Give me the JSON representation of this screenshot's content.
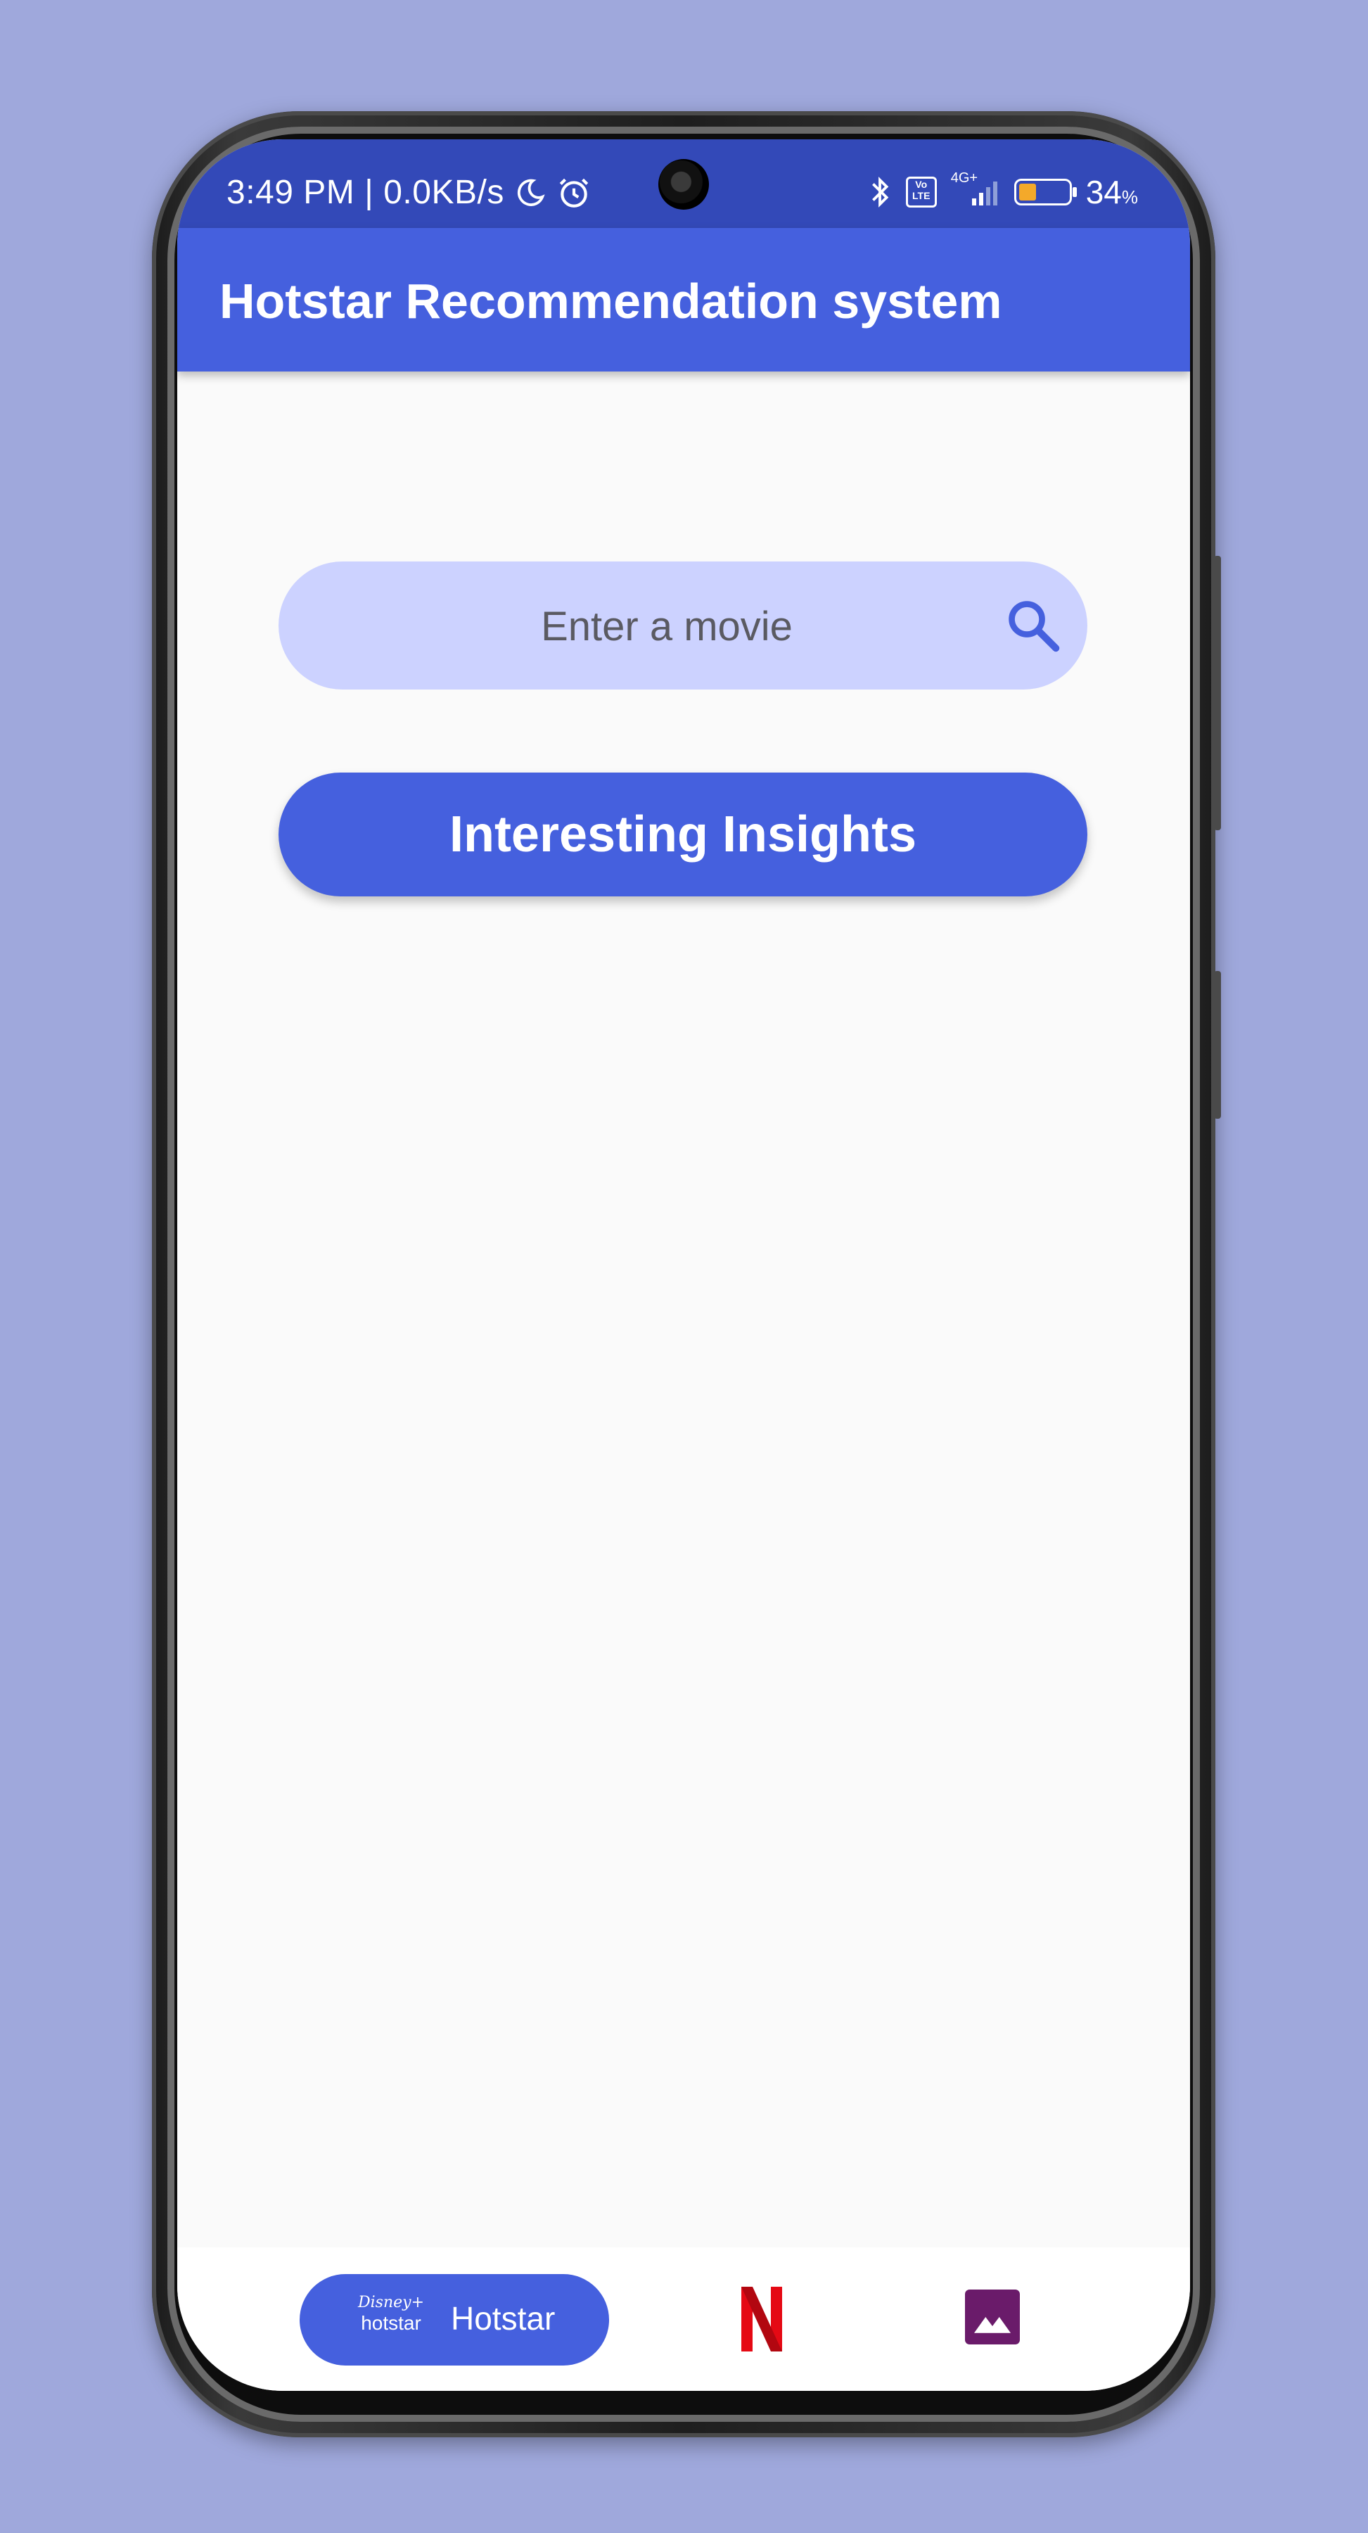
{
  "status_bar": {
    "time": "3:49 PM",
    "separator": "|",
    "network_speed": "0.0KB/s",
    "battery_percent": "34",
    "battery_unit": "%",
    "icons": [
      "moon-icon",
      "alarm-icon",
      "bluetooth-icon",
      "volte-icon",
      "signal-icon",
      "battery-icon"
    ],
    "volte_label": "Vo LTE",
    "network_type": "4G+"
  },
  "app_bar": {
    "title": "Hotstar Recommendation system"
  },
  "search": {
    "placeholder": "Enter a movie",
    "value": "",
    "icon": "search-icon"
  },
  "insights_button": {
    "label": "Interesting Insights"
  },
  "bottom_nav": {
    "items": [
      {
        "label": "Hotstar",
        "icon": "disney-hotstar-logo",
        "logo_line1": "Disney+",
        "logo_line2": "hotstar",
        "active": true
      },
      {
        "label": "",
        "icon": "netflix-icon",
        "active": false
      },
      {
        "label": "",
        "icon": "gallery-icon",
        "active": false
      }
    ]
  },
  "colors": {
    "background": "#9fa8dc",
    "status_bar": "#3349b8",
    "primary": "#4560de",
    "search_fill": "#ccd2ff",
    "screen": "#fafafa",
    "netflix_red": "#e50914",
    "gallery_purple": "#6a1b6a"
  }
}
